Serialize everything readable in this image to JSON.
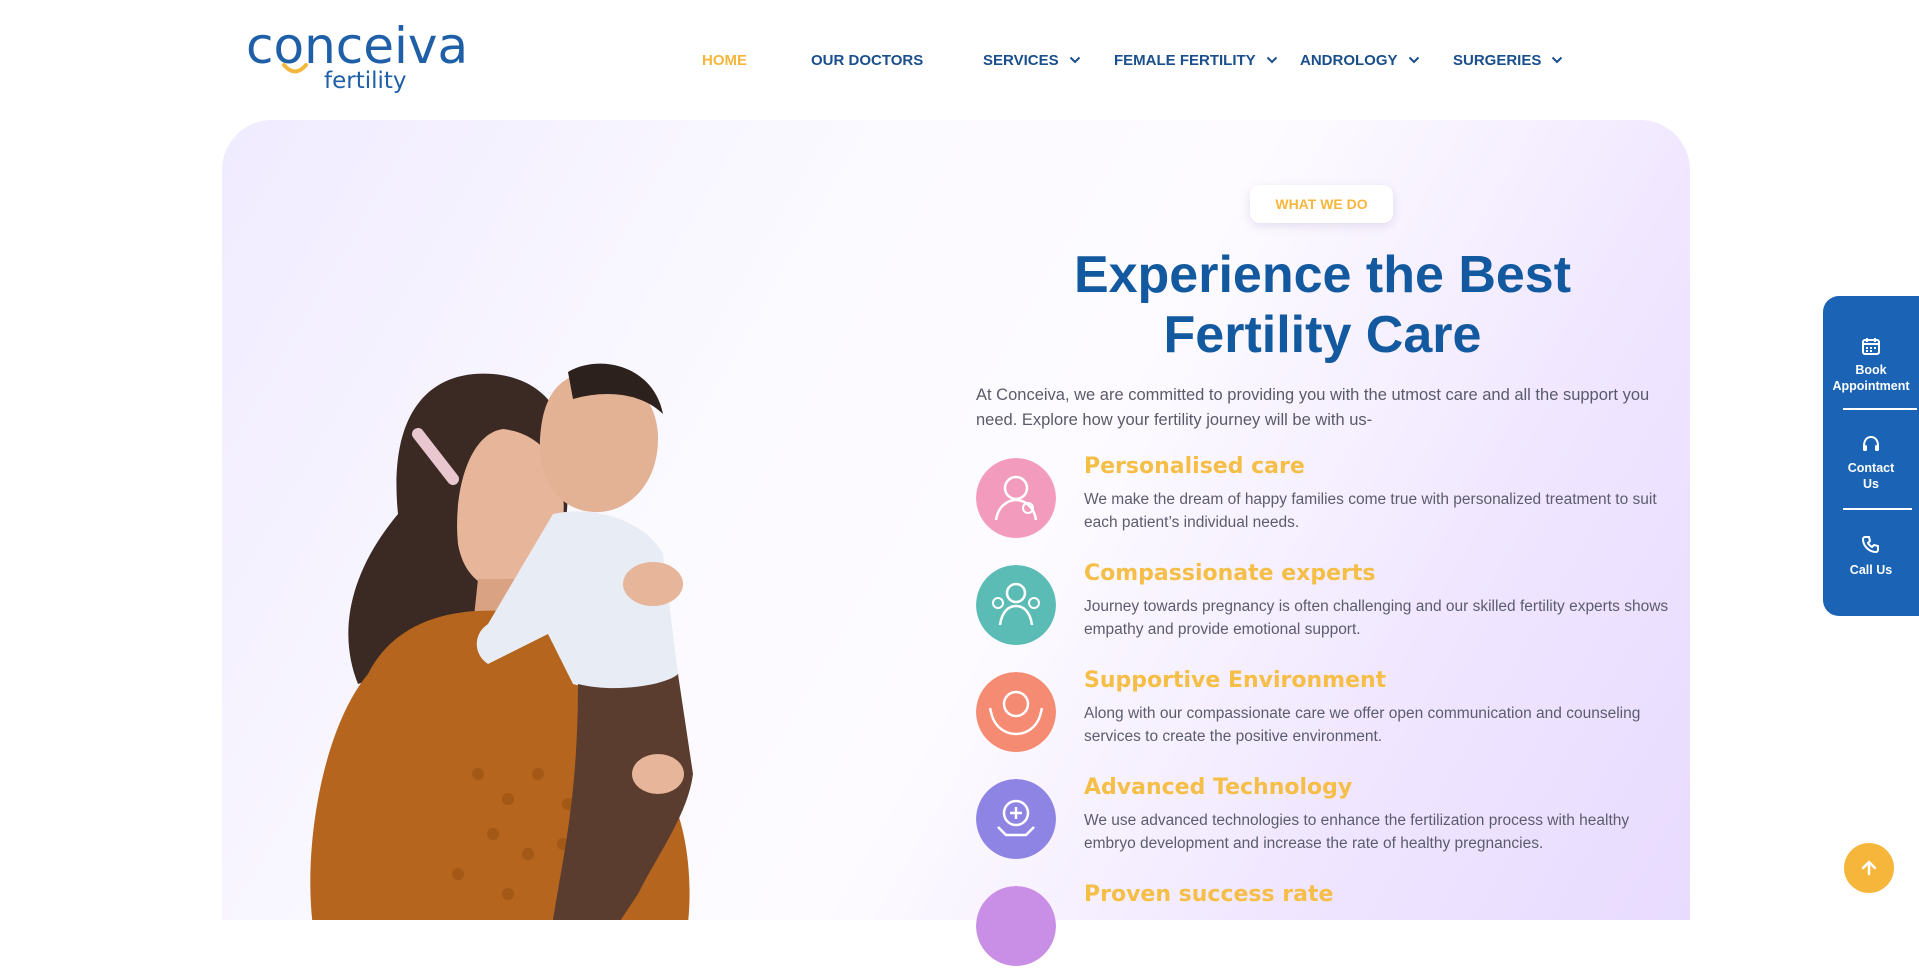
{
  "logo": {
    "name": "conceiva",
    "tagline": "fertility"
  },
  "nav": {
    "items": [
      {
        "label": "HOME",
        "active": true,
        "dropdown": false
      },
      {
        "label": "OUR DOCTORS",
        "active": false,
        "dropdown": false
      },
      {
        "label": "SERVICES",
        "active": false,
        "dropdown": true
      },
      {
        "label": "FEMALE FERTILITY",
        "active": false,
        "dropdown": true
      },
      {
        "label": "ANDROLOGY",
        "active": false,
        "dropdown": true
      },
      {
        "label": "SURGERIES",
        "active": false,
        "dropdown": true
      }
    ]
  },
  "hero": {
    "badge": "WHAT WE DO",
    "title_line1": "Experience the Best",
    "title_line2": "Fertility Care",
    "intro": "At Conceiva, we are committed to providing you with the utmost care and all the support you need. Explore how your fertility journey will be with us-",
    "features": [
      {
        "title": "Personalised care",
        "desc": "We make the dream of happy families come true with personalized treatment to suit each patient’s individual needs.",
        "icon": "mother-baby-icon",
        "color": "#f29bbd"
      },
      {
        "title": "Compassionate experts",
        "desc": "Journey towards pregnancy is often challenging and our skilled fertility experts shows empathy and provide emotional support.",
        "icon": "doctors-icon",
        "color": "#5bbcb6"
      },
      {
        "title": "Supportive Environment",
        "desc": "Along with our compassionate care we offer open communication and counseling services to create the positive environment.",
        "icon": "caring-hands-icon",
        "color": "#f58b73"
      },
      {
        "title": "Advanced Technology",
        "desc": "We use advanced technologies to enhance the fertilization process with healthy embryo development and increase the rate of healthy pregnancies.",
        "icon": "medical-tech-icon",
        "color": "#8e84e3"
      },
      {
        "title": "Proven success rate",
        "desc": "",
        "icon": "success-icon",
        "color": "#c98fe6"
      }
    ]
  },
  "side_panel": {
    "book": "Book Appointment",
    "contact": "Contact Us",
    "call": "Call Us"
  },
  "colors": {
    "brand_blue": "#13599f",
    "accent_yellow": "#f5b63b",
    "side_panel": "#1a63b5"
  }
}
